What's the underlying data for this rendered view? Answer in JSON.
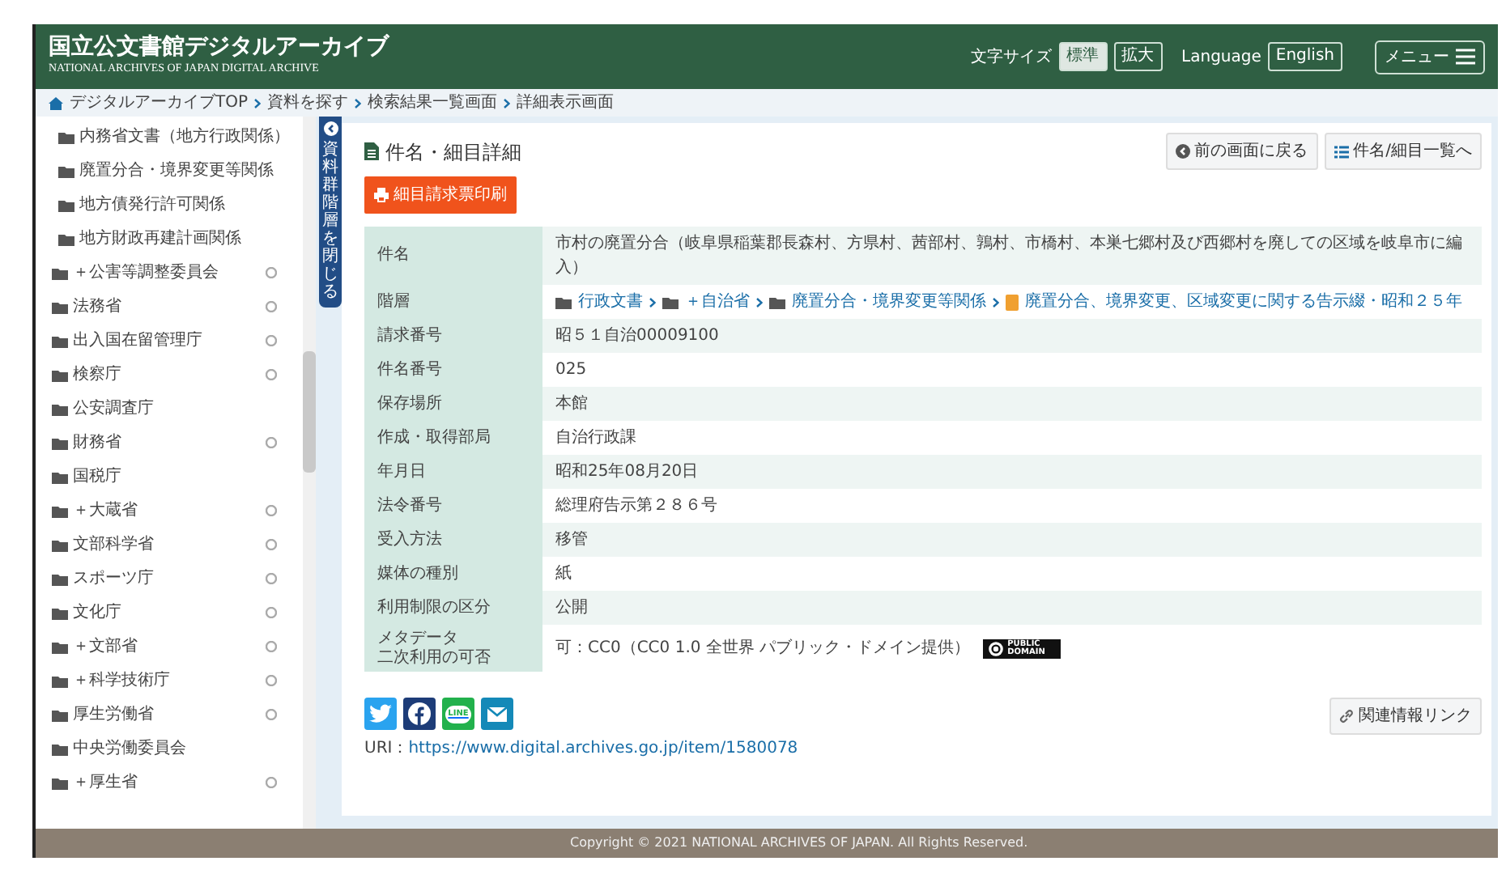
{
  "header": {
    "logo_title": "国立公文書館デジタルアーカイブ",
    "logo_subtitle": "NATIONAL ARCHIVES OF JAPAN DIGITAL ARCHIVE",
    "font_size_label": "文字サイズ",
    "font_sizes": [
      {
        "label": "標準",
        "selected": true
      },
      {
        "label": "拡大",
        "selected": false
      }
    ],
    "language_label": "Language",
    "language_button": "English",
    "menu_button": "メニュー"
  },
  "breadcrumb": [
    "デジタルアーカイブTOP",
    "資料を探す",
    "検索結果一覧画面",
    "詳細表示画面"
  ],
  "sidebar": {
    "nested_items": [
      "内務省文書（地方行政関係）",
      "廃置分合・境界変更等関係",
      "地方債発行許可関係",
      "地方財政再建計画関係"
    ],
    "items": [
      {
        "label": "＋公害等調整委員会",
        "expandable": true
      },
      {
        "label": "法務省",
        "expandable": true
      },
      {
        "label": "出入国在留管理庁",
        "expandable": true
      },
      {
        "label": "検察庁",
        "expandable": true
      },
      {
        "label": "公安調査庁",
        "expandable": false
      },
      {
        "label": "財務省",
        "expandable": true
      },
      {
        "label": "国税庁",
        "expandable": false
      },
      {
        "label": "＋大蔵省",
        "expandable": true
      },
      {
        "label": "文部科学省",
        "expandable": true
      },
      {
        "label": "スポーツ庁",
        "expandable": true
      },
      {
        "label": "文化庁",
        "expandable": true
      },
      {
        "label": "＋文部省",
        "expandable": true
      },
      {
        "label": "＋科学技術庁",
        "expandable": true
      },
      {
        "label": "厚生労働省",
        "expandable": true
      },
      {
        "label": "中央労働委員会",
        "expandable": false
      },
      {
        "label": "＋厚生省",
        "expandable": true
      }
    ],
    "collapse_tab": "資料群階層を閉じる"
  },
  "main": {
    "title": "件名・細目詳細",
    "back_button": "前の画面に戻る",
    "list_button": "件名/細目一覧へ",
    "print_button": "細目請求票印刷",
    "details": [
      {
        "kind": "text",
        "label": "件名",
        "value": "市村の廃置分合（岐阜県稲葉郡長森村、方県村、茜部村、鶉村、市橋村、本巣七郷村及び西郷村を廃しての区域を岐阜市に編入）"
      },
      {
        "kind": "path",
        "label": "階層",
        "path": [
          "行政文書",
          "＋自治省",
          "廃置分合・境界変更等関係",
          "廃置分合、境界変更、区域変更に関する告示綴・昭和２５年"
        ]
      },
      {
        "kind": "text",
        "label": "請求番号",
        "value": "昭５１自治00009100"
      },
      {
        "kind": "text",
        "label": "件名番号",
        "value": "025"
      },
      {
        "kind": "text",
        "label": "保存場所",
        "value": "本館"
      },
      {
        "kind": "text",
        "label": "作成・取得部局",
        "value": "自治行政課"
      },
      {
        "kind": "text",
        "label": "年月日",
        "value": "昭和25年08月20日"
      },
      {
        "kind": "text",
        "label": "法令番号",
        "value": "総理府告示第２８６号"
      },
      {
        "kind": "text",
        "label": "受入方法",
        "value": "移管"
      },
      {
        "kind": "text",
        "label": "媒体の種別",
        "value": "紙"
      },
      {
        "kind": "text",
        "label": "利用制限の区分",
        "value": "公開"
      },
      {
        "kind": "license",
        "label_lines": [
          "メタデータ",
          "二次利用の可否"
        ],
        "value": "可：CC0（CC0 1.0 全世界 パブリック・ドメイン提供）",
        "badge": "PUBLIC DOMAIN"
      }
    ],
    "share_buttons": [
      {
        "kind": "twitter"
      },
      {
        "kind": "facebook"
      },
      {
        "kind": "line",
        "label": "LINE"
      },
      {
        "kind": "mail"
      }
    ],
    "uri_label": "URI：",
    "uri": "https://www.digital.archives.go.jp/item/1580078",
    "related_link_button": "関連情報リンク"
  },
  "footer": "Copyright © 2021 NATIONAL ARCHIVES OF JAPAN. All Rights Reserved."
}
